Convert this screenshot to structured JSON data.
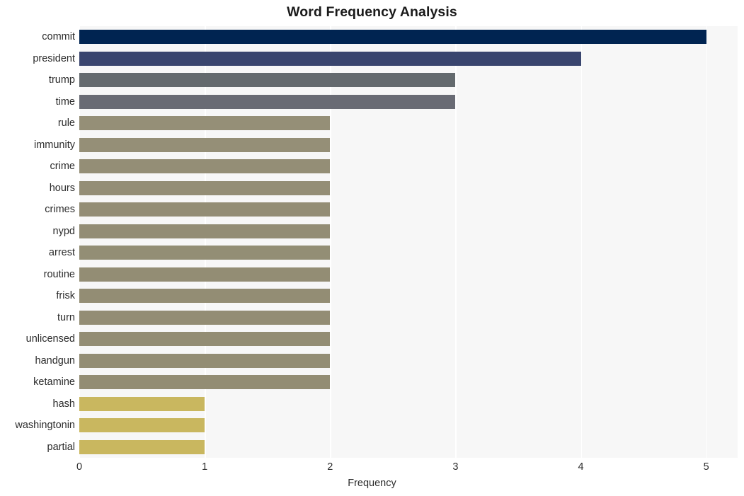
{
  "chart_data": {
    "type": "bar",
    "orientation": "horizontal",
    "title": "Word Frequency Analysis",
    "xlabel": "Frequency",
    "ylabel": "",
    "categories": [
      "commit",
      "president",
      "trump",
      "time",
      "rule",
      "immunity",
      "crime",
      "hours",
      "crimes",
      "nypd",
      "arrest",
      "routine",
      "frisk",
      "turn",
      "unlicensed",
      "handgun",
      "ketamine",
      "hash",
      "washingtonin",
      "partial"
    ],
    "values": [
      5,
      4,
      3,
      3,
      2,
      2,
      2,
      2,
      2,
      2,
      2,
      2,
      2,
      2,
      2,
      2,
      2,
      1,
      1,
      1
    ],
    "bar_colors": [
      "#002451",
      "#39456e",
      "#646a6e",
      "#696b74",
      "#958f77",
      "#958f77",
      "#948e76",
      "#948e76",
      "#938d75",
      "#938d75",
      "#938e75",
      "#938d74",
      "#938d74",
      "#938d74",
      "#938d74",
      "#938d74",
      "#938d74",
      "#c9b75f",
      "#c9b75f",
      "#c9b75f"
    ],
    "xlim": [
      0,
      5.25
    ],
    "xticks": [
      0,
      1,
      2,
      3,
      4,
      5
    ],
    "xticklabels": [
      "0",
      "1",
      "2",
      "3",
      "4",
      "5"
    ],
    "grid": true,
    "grid_axis": "x",
    "grid_color": "#ffffff",
    "plot_background": "#f7f7f7",
    "figure_background": "#ffffff",
    "legend": null
  }
}
